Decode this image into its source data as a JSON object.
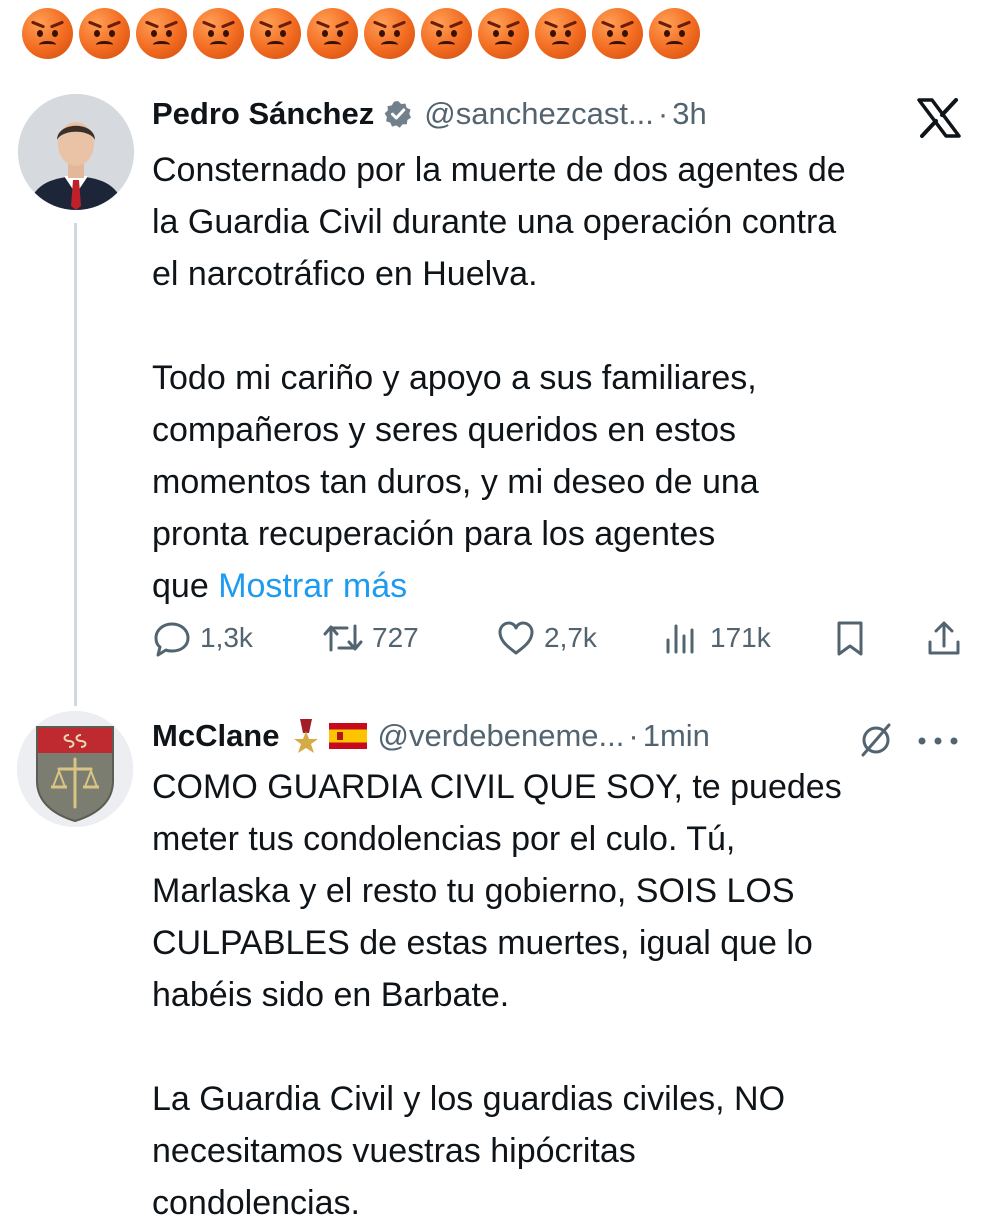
{
  "reaction_row": {
    "emoji_count": 12,
    "emoji": "angry-face"
  },
  "original_tweet": {
    "author_name": "Pedro Sánchez",
    "handle": "@sanchezcast...",
    "separator": "·",
    "time": "3h",
    "text_main": "Consternado por la muerte de dos agentes de\nla Guardia Civil durante una operación contra\nel narcotráfico en Huelva.\n\nTodo mi cariño y apoyo a sus familiares,\ncompañeros y seres queridos en estos\nmomentos tan duros, y mi deseo de una\npronta recuperación para los agentes\nque ",
    "show_more": "Mostrar más",
    "stats": {
      "replies": "1,3k",
      "reposts": "727",
      "likes": "2,7k",
      "views": "171k"
    }
  },
  "reply_tweet": {
    "author_name": "McClane",
    "handle": "@verdebeneme...",
    "separator": "·",
    "time": "1min",
    "text": "COMO GUARDIA CIVIL QUE SOY, te puedes\nmeter tus condolencias por el culo. Tú,\nMarlaska y el resto tu gobierno, SOIS LOS\nCULPABLES de estas muertes, igual que lo\nhabéis sido en Barbate.\n\nLa Guardia Civil y los guardias civiles, NO\nnecesitamos vuestras hipócritas\ncondolencias."
  },
  "colors": {
    "text": "#0f1419",
    "secondary": "#536471",
    "link": "#1d9bf0",
    "thread_line": "#cfd9de"
  }
}
